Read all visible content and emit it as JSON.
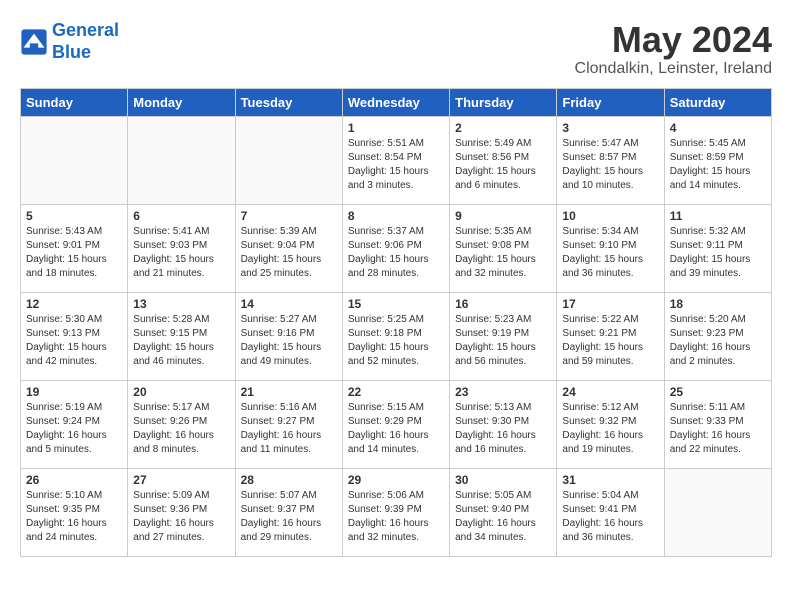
{
  "logo": {
    "line1": "General",
    "line2": "Blue"
  },
  "title": "May 2024",
  "subtitle": "Clondalkin, Leinster, Ireland",
  "weekdays": [
    "Sunday",
    "Monday",
    "Tuesday",
    "Wednesday",
    "Thursday",
    "Friday",
    "Saturday"
  ],
  "weeks": [
    [
      {
        "day": "",
        "info": ""
      },
      {
        "day": "",
        "info": ""
      },
      {
        "day": "",
        "info": ""
      },
      {
        "day": "1",
        "info": "Sunrise: 5:51 AM\nSunset: 8:54 PM\nDaylight: 15 hours\nand 3 minutes."
      },
      {
        "day": "2",
        "info": "Sunrise: 5:49 AM\nSunset: 8:56 PM\nDaylight: 15 hours\nand 6 minutes."
      },
      {
        "day": "3",
        "info": "Sunrise: 5:47 AM\nSunset: 8:57 PM\nDaylight: 15 hours\nand 10 minutes."
      },
      {
        "day": "4",
        "info": "Sunrise: 5:45 AM\nSunset: 8:59 PM\nDaylight: 15 hours\nand 14 minutes."
      }
    ],
    [
      {
        "day": "5",
        "info": "Sunrise: 5:43 AM\nSunset: 9:01 PM\nDaylight: 15 hours\nand 18 minutes."
      },
      {
        "day": "6",
        "info": "Sunrise: 5:41 AM\nSunset: 9:03 PM\nDaylight: 15 hours\nand 21 minutes."
      },
      {
        "day": "7",
        "info": "Sunrise: 5:39 AM\nSunset: 9:04 PM\nDaylight: 15 hours\nand 25 minutes."
      },
      {
        "day": "8",
        "info": "Sunrise: 5:37 AM\nSunset: 9:06 PM\nDaylight: 15 hours\nand 28 minutes."
      },
      {
        "day": "9",
        "info": "Sunrise: 5:35 AM\nSunset: 9:08 PM\nDaylight: 15 hours\nand 32 minutes."
      },
      {
        "day": "10",
        "info": "Sunrise: 5:34 AM\nSunset: 9:10 PM\nDaylight: 15 hours\nand 36 minutes."
      },
      {
        "day": "11",
        "info": "Sunrise: 5:32 AM\nSunset: 9:11 PM\nDaylight: 15 hours\nand 39 minutes."
      }
    ],
    [
      {
        "day": "12",
        "info": "Sunrise: 5:30 AM\nSunset: 9:13 PM\nDaylight: 15 hours\nand 42 minutes."
      },
      {
        "day": "13",
        "info": "Sunrise: 5:28 AM\nSunset: 9:15 PM\nDaylight: 15 hours\nand 46 minutes."
      },
      {
        "day": "14",
        "info": "Sunrise: 5:27 AM\nSunset: 9:16 PM\nDaylight: 15 hours\nand 49 minutes."
      },
      {
        "day": "15",
        "info": "Sunrise: 5:25 AM\nSunset: 9:18 PM\nDaylight: 15 hours\nand 52 minutes."
      },
      {
        "day": "16",
        "info": "Sunrise: 5:23 AM\nSunset: 9:19 PM\nDaylight: 15 hours\nand 56 minutes."
      },
      {
        "day": "17",
        "info": "Sunrise: 5:22 AM\nSunset: 9:21 PM\nDaylight: 15 hours\nand 59 minutes."
      },
      {
        "day": "18",
        "info": "Sunrise: 5:20 AM\nSunset: 9:23 PM\nDaylight: 16 hours\nand 2 minutes."
      }
    ],
    [
      {
        "day": "19",
        "info": "Sunrise: 5:19 AM\nSunset: 9:24 PM\nDaylight: 16 hours\nand 5 minutes."
      },
      {
        "day": "20",
        "info": "Sunrise: 5:17 AM\nSunset: 9:26 PM\nDaylight: 16 hours\nand 8 minutes."
      },
      {
        "day": "21",
        "info": "Sunrise: 5:16 AM\nSunset: 9:27 PM\nDaylight: 16 hours\nand 11 minutes."
      },
      {
        "day": "22",
        "info": "Sunrise: 5:15 AM\nSunset: 9:29 PM\nDaylight: 16 hours\nand 14 minutes."
      },
      {
        "day": "23",
        "info": "Sunrise: 5:13 AM\nSunset: 9:30 PM\nDaylight: 16 hours\nand 16 minutes."
      },
      {
        "day": "24",
        "info": "Sunrise: 5:12 AM\nSunset: 9:32 PM\nDaylight: 16 hours\nand 19 minutes."
      },
      {
        "day": "25",
        "info": "Sunrise: 5:11 AM\nSunset: 9:33 PM\nDaylight: 16 hours\nand 22 minutes."
      }
    ],
    [
      {
        "day": "26",
        "info": "Sunrise: 5:10 AM\nSunset: 9:35 PM\nDaylight: 16 hours\nand 24 minutes."
      },
      {
        "day": "27",
        "info": "Sunrise: 5:09 AM\nSunset: 9:36 PM\nDaylight: 16 hours\nand 27 minutes."
      },
      {
        "day": "28",
        "info": "Sunrise: 5:07 AM\nSunset: 9:37 PM\nDaylight: 16 hours\nand 29 minutes."
      },
      {
        "day": "29",
        "info": "Sunrise: 5:06 AM\nSunset: 9:39 PM\nDaylight: 16 hours\nand 32 minutes."
      },
      {
        "day": "30",
        "info": "Sunrise: 5:05 AM\nSunset: 9:40 PM\nDaylight: 16 hours\nand 34 minutes."
      },
      {
        "day": "31",
        "info": "Sunrise: 5:04 AM\nSunset: 9:41 PM\nDaylight: 16 hours\nand 36 minutes."
      },
      {
        "day": "",
        "info": ""
      }
    ]
  ]
}
